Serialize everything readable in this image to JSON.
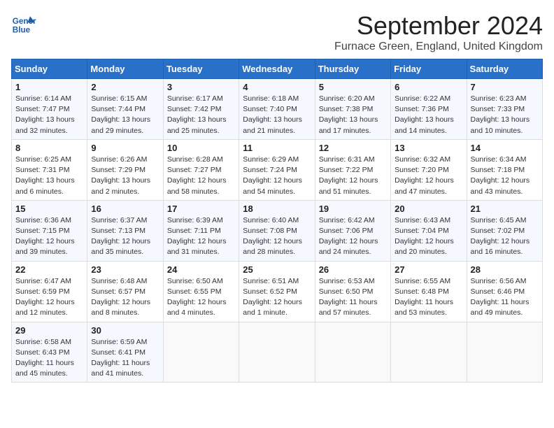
{
  "header": {
    "logo_line1": "General",
    "logo_line2": "Blue",
    "title": "September 2024",
    "location": "Furnace Green, England, United Kingdom"
  },
  "weekdays": [
    "Sunday",
    "Monday",
    "Tuesday",
    "Wednesday",
    "Thursday",
    "Friday",
    "Saturday"
  ],
  "weeks": [
    [
      {
        "day": "1",
        "detail": "Sunrise: 6:14 AM\nSunset: 7:47 PM\nDaylight: 13 hours\nand 32 minutes."
      },
      {
        "day": "2",
        "detail": "Sunrise: 6:15 AM\nSunset: 7:44 PM\nDaylight: 13 hours\nand 29 minutes."
      },
      {
        "day": "3",
        "detail": "Sunrise: 6:17 AM\nSunset: 7:42 PM\nDaylight: 13 hours\nand 25 minutes."
      },
      {
        "day": "4",
        "detail": "Sunrise: 6:18 AM\nSunset: 7:40 PM\nDaylight: 13 hours\nand 21 minutes."
      },
      {
        "day": "5",
        "detail": "Sunrise: 6:20 AM\nSunset: 7:38 PM\nDaylight: 13 hours\nand 17 minutes."
      },
      {
        "day": "6",
        "detail": "Sunrise: 6:22 AM\nSunset: 7:36 PM\nDaylight: 13 hours\nand 14 minutes."
      },
      {
        "day": "7",
        "detail": "Sunrise: 6:23 AM\nSunset: 7:33 PM\nDaylight: 13 hours\nand 10 minutes."
      }
    ],
    [
      {
        "day": "8",
        "detail": "Sunrise: 6:25 AM\nSunset: 7:31 PM\nDaylight: 13 hours\nand 6 minutes."
      },
      {
        "day": "9",
        "detail": "Sunrise: 6:26 AM\nSunset: 7:29 PM\nDaylight: 13 hours\nand 2 minutes."
      },
      {
        "day": "10",
        "detail": "Sunrise: 6:28 AM\nSunset: 7:27 PM\nDaylight: 12 hours\nand 58 minutes."
      },
      {
        "day": "11",
        "detail": "Sunrise: 6:29 AM\nSunset: 7:24 PM\nDaylight: 12 hours\nand 54 minutes."
      },
      {
        "day": "12",
        "detail": "Sunrise: 6:31 AM\nSunset: 7:22 PM\nDaylight: 12 hours\nand 51 minutes."
      },
      {
        "day": "13",
        "detail": "Sunrise: 6:32 AM\nSunset: 7:20 PM\nDaylight: 12 hours\nand 47 minutes."
      },
      {
        "day": "14",
        "detail": "Sunrise: 6:34 AM\nSunset: 7:18 PM\nDaylight: 12 hours\nand 43 minutes."
      }
    ],
    [
      {
        "day": "15",
        "detail": "Sunrise: 6:36 AM\nSunset: 7:15 PM\nDaylight: 12 hours\nand 39 minutes."
      },
      {
        "day": "16",
        "detail": "Sunrise: 6:37 AM\nSunset: 7:13 PM\nDaylight: 12 hours\nand 35 minutes."
      },
      {
        "day": "17",
        "detail": "Sunrise: 6:39 AM\nSunset: 7:11 PM\nDaylight: 12 hours\nand 31 minutes."
      },
      {
        "day": "18",
        "detail": "Sunrise: 6:40 AM\nSunset: 7:08 PM\nDaylight: 12 hours\nand 28 minutes."
      },
      {
        "day": "19",
        "detail": "Sunrise: 6:42 AM\nSunset: 7:06 PM\nDaylight: 12 hours\nand 24 minutes."
      },
      {
        "day": "20",
        "detail": "Sunrise: 6:43 AM\nSunset: 7:04 PM\nDaylight: 12 hours\nand 20 minutes."
      },
      {
        "day": "21",
        "detail": "Sunrise: 6:45 AM\nSunset: 7:02 PM\nDaylight: 12 hours\nand 16 minutes."
      }
    ],
    [
      {
        "day": "22",
        "detail": "Sunrise: 6:47 AM\nSunset: 6:59 PM\nDaylight: 12 hours\nand 12 minutes."
      },
      {
        "day": "23",
        "detail": "Sunrise: 6:48 AM\nSunset: 6:57 PM\nDaylight: 12 hours\nand 8 minutes."
      },
      {
        "day": "24",
        "detail": "Sunrise: 6:50 AM\nSunset: 6:55 PM\nDaylight: 12 hours\nand 4 minutes."
      },
      {
        "day": "25",
        "detail": "Sunrise: 6:51 AM\nSunset: 6:52 PM\nDaylight: 12 hours\nand 1 minute."
      },
      {
        "day": "26",
        "detail": "Sunrise: 6:53 AM\nSunset: 6:50 PM\nDaylight: 11 hours\nand 57 minutes."
      },
      {
        "day": "27",
        "detail": "Sunrise: 6:55 AM\nSunset: 6:48 PM\nDaylight: 11 hours\nand 53 minutes."
      },
      {
        "day": "28",
        "detail": "Sunrise: 6:56 AM\nSunset: 6:46 PM\nDaylight: 11 hours\nand 49 minutes."
      }
    ],
    [
      {
        "day": "29",
        "detail": "Sunrise: 6:58 AM\nSunset: 6:43 PM\nDaylight: 11 hours\nand 45 minutes."
      },
      {
        "day": "30",
        "detail": "Sunrise: 6:59 AM\nSunset: 6:41 PM\nDaylight: 11 hours\nand 41 minutes."
      },
      {
        "day": "",
        "detail": ""
      },
      {
        "day": "",
        "detail": ""
      },
      {
        "day": "",
        "detail": ""
      },
      {
        "day": "",
        "detail": ""
      },
      {
        "day": "",
        "detail": ""
      }
    ]
  ]
}
